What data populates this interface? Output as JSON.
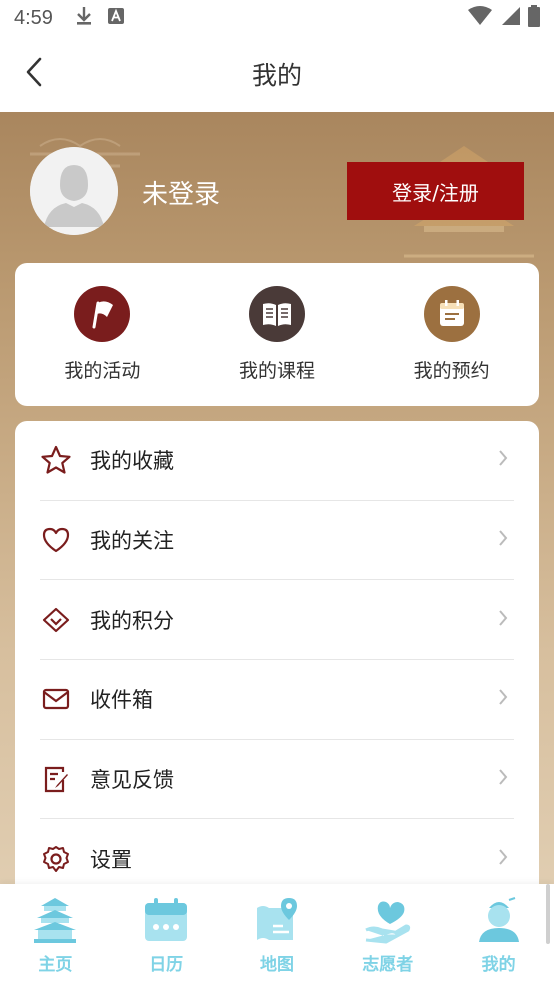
{
  "status_bar": {
    "time": "4:59",
    "icons": [
      "download-icon",
      "a-box-icon",
      "wifi-icon",
      "signal-icon",
      "battery-icon"
    ]
  },
  "header": {
    "title": "我的",
    "back_icon": "chevron-left-icon"
  },
  "profile": {
    "name": "未登录",
    "login_button": "登录/注册",
    "avatar_icon": "avatar-placeholder-icon"
  },
  "quick_actions": [
    {
      "label": "我的活动",
      "icon": "flag-icon",
      "color": "#7a1d1d"
    },
    {
      "label": "我的课程",
      "icon": "book-icon",
      "color": "#4a3a38"
    },
    {
      "label": "我的预约",
      "icon": "calendar-icon",
      "color": "#9c7040"
    }
  ],
  "menu": [
    {
      "label": "我的收藏",
      "icon": "star-icon"
    },
    {
      "label": "我的关注",
      "icon": "heart-icon"
    },
    {
      "label": "我的积分",
      "icon": "diamond-icon"
    },
    {
      "label": "收件箱",
      "icon": "mail-icon"
    },
    {
      "label": "意见反馈",
      "icon": "feedback-icon"
    },
    {
      "label": "设置",
      "icon": "gear-icon"
    }
  ],
  "bottom_nav": [
    {
      "label": "主页",
      "icon": "pavilion-icon"
    },
    {
      "label": "日历",
      "icon": "calendar-icon"
    },
    {
      "label": "地图",
      "icon": "map-icon"
    },
    {
      "label": "志愿者",
      "icon": "hand-heart-icon"
    },
    {
      "label": "我的",
      "icon": "person-icon"
    }
  ],
  "colors": {
    "accent": "#a00e0e",
    "icon_red": "#7a1d1d",
    "nav_cyan": "#7fd3e6"
  }
}
